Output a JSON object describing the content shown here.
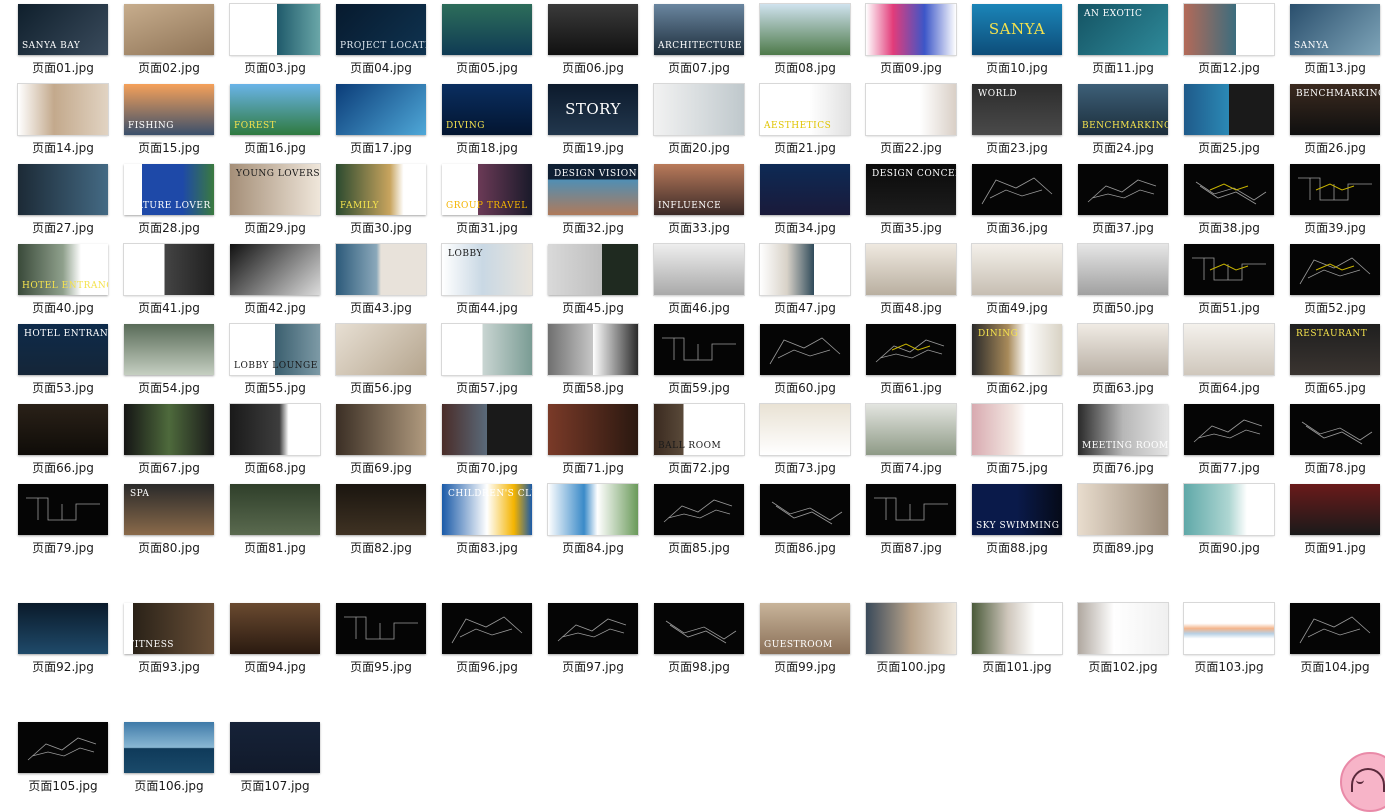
{
  "files": [
    {
      "name": "页面01.jpg",
      "bg": "linear-gradient(135deg,#0f1f2c,#3a4b5c)",
      "caption": "SANYA BAY",
      "ccolor": "#ffffff"
    },
    {
      "name": "页面02.jpg",
      "bg": "linear-gradient(160deg,#c7ad8d,#8f7457)"
    },
    {
      "name": "页面03.jpg",
      "bg": "linear-gradient(90deg,#ffffff 0%,#ffffff 52%,#1f5a6b 52%,#6aa7a8 100%)",
      "light": true
    },
    {
      "name": "页面04.jpg",
      "bg": "linear-gradient(135deg,#071a2e,#0f3350)",
      "caption": "PROJECT LOCATION",
      "ccolor": "#dfe8f0"
    },
    {
      "name": "页面05.jpg",
      "bg": "linear-gradient(180deg,#2d6d5a,#0f3b54)"
    },
    {
      "name": "页面06.jpg",
      "bg": "linear-gradient(180deg,#3a3a3a,#111111)"
    },
    {
      "name": "页面07.jpg",
      "bg": "linear-gradient(180deg,#6a86a0,#1e2e3b)",
      "caption": "ARCHITECTURE",
      "ccolor": "#ffffff"
    },
    {
      "name": "页面08.jpg",
      "bg": "linear-gradient(180deg,#cfe2ee,#4e7a4a)",
      "light": true
    },
    {
      "name": "页面09.jpg",
      "bg": "linear-gradient(90deg,#ffffff 0%,#e23c7a 30%,#3c56c8 65%,#ffffff 100%)",
      "light": true
    },
    {
      "name": "页面10.jpg",
      "bg": "linear-gradient(180deg,#1b85b8,#0d4d79)",
      "caption": "SANYA",
      "ccolor": "#f4e24d",
      "big": true
    },
    {
      "name": "页面11.jpg",
      "bg": "linear-gradient(135deg,#145363,#2f8a9a)",
      "caption": "AN EXOTIC",
      "ccolor": "#ffffff"
    },
    {
      "name": "页面12.jpg",
      "bg": "linear-gradient(90deg,#b36a58 0%,#3b6d7e 58%,#ffffff 58%)",
      "light": true
    },
    {
      "name": "页面13.jpg",
      "bg": "linear-gradient(135deg,#2a4f6d,#7ea4b8)",
      "caption": "SANYA",
      "ccolor": "#ffffff"
    },
    {
      "name": "页面14.jpg",
      "bg": "linear-gradient(90deg,#ffffff 0%,#c3a98c 40%,#e1d3c2 100%)",
      "light": true
    },
    {
      "name": "页面15.jpg",
      "bg": "linear-gradient(180deg,#f5a15a,#3a4f6b)",
      "caption": "FISHING",
      "ccolor": "#ffffff"
    },
    {
      "name": "页面16.jpg",
      "bg": "linear-gradient(180deg,#6ab4e8,#2f7a3f)",
      "caption": "FOREST",
      "ccolor": "#f4e24d"
    },
    {
      "name": "页面17.jpg",
      "bg": "linear-gradient(135deg,#0b3c78,#4fa8d8)"
    },
    {
      "name": "页面18.jpg",
      "bg": "linear-gradient(180deg,#0a2e60,#031530)",
      "caption": "DIVING",
      "ccolor": "#f4e24d"
    },
    {
      "name": "页面19.jpg",
      "bg": "linear-gradient(180deg,#0c1a2c,#22374d)",
      "caption": "STORY",
      "ccolor": "#ffffff",
      "big": true
    },
    {
      "name": "页面20.jpg",
      "bg": "linear-gradient(90deg,#f2f2f2,#bfc8cc)",
      "light": true
    },
    {
      "name": "页面21.jpg",
      "bg": "linear-gradient(90deg,#ffffff 0%,#ffffff 55%,#e0e0e0 100%)",
      "caption": "AESTHETICS",
      "ccolor": "#e0c400",
      "light": true
    },
    {
      "name": "页面22.jpg",
      "bg": "linear-gradient(90deg,#ffffff 0%,#ffffff 60%,#d9cfc6 100%)",
      "light": true
    },
    {
      "name": "页面23.jpg",
      "bg": "linear-gradient(180deg,#2c2c2c,#4a4a4a)",
      "caption": "WORLD",
      "ccolor": "#ffffff"
    },
    {
      "name": "页面24.jpg",
      "bg": "linear-gradient(180deg,#3d5f78,#1c2e3b)",
      "caption": "BENCHMARKING",
      "ccolor": "#f4e24d"
    },
    {
      "name": "页面25.jpg",
      "bg": "linear-gradient(90deg,#1f5a8a 0%,#2b89b5 50%,#1a1a1a 50%)"
    },
    {
      "name": "页面26.jpg",
      "bg": "linear-gradient(180deg,#3b2a1f,#0f0f0f)",
      "caption": "BENCHMARKING",
      "ccolor": "#ffffff"
    },
    {
      "name": "页面27.jpg",
      "bg": "linear-gradient(90deg,#1c2a36,#446a84)"
    },
    {
      "name": "页面28.jpg",
      "bg": "linear-gradient(90deg,#ffffff 0%,#ffffff 20%,#1e49a8 20%,#1e49a8 65%,#3a7a3f 100%)",
      "caption": "NATURE LOVER",
      "ccolor": "#ffffff"
    },
    {
      "name": "页面29.jpg",
      "bg": "linear-gradient(90deg,#a58f78,#efe6da)",
      "caption": "YOUNG LOVERS",
      "ccolor": "#1a1a1a",
      "light": true
    },
    {
      "name": "页面30.jpg",
      "bg": "linear-gradient(90deg,#2b4a2f 0%,#c8a45e 60%,#ffffff 75%)",
      "caption": "FAMILY",
      "ccolor": "#f4e24d"
    },
    {
      "name": "页面31.jpg",
      "bg": "linear-gradient(90deg,#ffffff 0%,#ffffff 40%,#6b3a56 40%,#1a1a2a 100%)",
      "caption": "GROUP TRAVEL",
      "ccolor": "#f4b400"
    },
    {
      "name": "页面32.jpg",
      "bg": "linear-gradient(180deg,#0f1f33 0%,#0f1f33 30%,#4f8fb5 30%,#b07a5a 100%)",
      "caption": "DESIGN VISION",
      "ccolor": "#ffffff"
    },
    {
      "name": "页面33.jpg",
      "bg": "linear-gradient(180deg,#b97a5a,#3a2a28)",
      "caption": "INFLUENCE",
      "ccolor": "#ffffff"
    },
    {
      "name": "页面34.jpg",
      "bg": "linear-gradient(180deg,#0d2a55,#1a1a3a)"
    },
    {
      "name": "页面35.jpg",
      "bg": "linear-gradient(180deg,#0a0a0a,#1d1d1d)",
      "caption": "DESIGN CONCEPT",
      "ccolor": "#ffffff"
    },
    {
      "name": "页面36.jpg",
      "bg": "#050505"
    },
    {
      "name": "页面37.jpg",
      "bg": "#050505"
    },
    {
      "name": "页面38.jpg",
      "bg": "#050505"
    },
    {
      "name": "页面39.jpg",
      "bg": "#050505"
    },
    {
      "name": "页面40.jpg",
      "bg": "linear-gradient(90deg,#3a4a3a 0%,#8fa08c 50%,#ffffff 70%)",
      "caption": "HOTEL ENTRANCE",
      "ccolor": "#f4e24d"
    },
    {
      "name": "页面41.jpg",
      "bg": "linear-gradient(90deg,#ffffff 0%,#ffffff 45%,#444444 45%,#1f1f1f 100%)",
      "light": true
    },
    {
      "name": "页面42.jpg",
      "bg": "linear-gradient(135deg,#111111,#dcdcdc)"
    },
    {
      "name": "页面43.jpg",
      "bg": "linear-gradient(90deg,#2c5a7a 0%,#8aa8ba 45%,#e8e2da 50%)",
      "light": true
    },
    {
      "name": "页面44.jpg",
      "bg": "linear-gradient(90deg,#ffffff 0%,#c9d8e4 45%,#e9e4dc 100%)",
      "caption": "LOBBY",
      "ccolor": "#1a1a1a",
      "light": true
    },
    {
      "name": "页面45.jpg",
      "bg": "linear-gradient(90deg,#d9d9d9 0%,#bfbfbf 60%,#1f2a20 60%)"
    },
    {
      "name": "页面46.jpg",
      "bg": "linear-gradient(180deg,#eeeeee,#a9a9a9)",
      "light": true
    },
    {
      "name": "页面47.jpg",
      "bg": "linear-gradient(90deg,#ffffff 0%,#d8d2c8 30%,#2f4a5a 60%,#ffffff 60%)",
      "light": true
    },
    {
      "name": "页面48.jpg",
      "bg": "linear-gradient(180deg,#efe9e0,#b9afa0)",
      "light": true
    },
    {
      "name": "页面49.jpg",
      "bg": "linear-gradient(180deg,#f4f0ea,#c6beb2)",
      "light": true
    },
    {
      "name": "页面50.jpg",
      "bg": "linear-gradient(180deg,#e6e6e6,#a0a0a0)",
      "light": true
    },
    {
      "name": "页面51.jpg",
      "bg": "#050505"
    },
    {
      "name": "页面52.jpg",
      "bg": "#050505"
    },
    {
      "name": "页面53.jpg",
      "bg": "linear-gradient(180deg,#0d2a4a,#152638)",
      "caption": "HOTEL ENTRANCE",
      "ccolor": "#ffffff"
    },
    {
      "name": "页面54.jpg",
      "bg": "linear-gradient(180deg,#596b58,#c5cfc1)"
    },
    {
      "name": "页面55.jpg",
      "bg": "linear-gradient(90deg,#ffffff 0%,#ffffff 50%,#3b5f6f 50%,#7d9aa6 100%)",
      "caption": "LOBBY LOUNGE",
      "ccolor": "#1a1a1a",
      "light": true
    },
    {
      "name": "页面56.jpg",
      "bg": "linear-gradient(135deg,#e7dfd3,#b5a58e)",
      "light": true
    },
    {
      "name": "页面57.jpg",
      "bg": "linear-gradient(90deg,#ffffff 0%,#ffffff 45%,#c9d5d2 45%,#7a9c94 100%)",
      "light": true
    },
    {
      "name": "页面58.jpg",
      "bg": "linear-gradient(90deg,#6f6f6f 0%,#c7c7c7 50%,#ffffff 50%,#2a2a2a 100%)",
      "light": true
    },
    {
      "name": "页面59.jpg",
      "bg": "#050505"
    },
    {
      "name": "页面60.jpg",
      "bg": "#050505"
    },
    {
      "name": "页面61.jpg",
      "bg": "#050505"
    },
    {
      "name": "页面62.jpg",
      "bg": "linear-gradient(90deg,#2a2a2a 0%,#a88a5a 40%,#ffffff 60%,#d8d2c4 100%)",
      "caption": "DINING",
      "ccolor": "#f4e24d"
    },
    {
      "name": "页面63.jpg",
      "bg": "linear-gradient(180deg,#f0ebe4,#b9b0a5)",
      "light": true
    },
    {
      "name": "页面64.jpg",
      "bg": "linear-gradient(180deg,#f4f1ec,#cfc7bc)",
      "light": true
    },
    {
      "name": "页面65.jpg",
      "bg": "linear-gradient(180deg,#1f1f1f,#3a3430)",
      "caption": "RESTAURANT",
      "ccolor": "#f4e24d"
    },
    {
      "name": "页面66.jpg",
      "bg": "linear-gradient(180deg,#2a2118,#0f0c08)"
    },
    {
      "name": "页面67.jpg",
      "bg": "linear-gradient(90deg,#151515 0%,#4e6a3c 50%,#1a1a1a 100%)"
    },
    {
      "name": "页面68.jpg",
      "bg": "linear-gradient(90deg,#1a1a1a 0%,#3d3d3d 55%,#ffffff 65%)",
      "light": true
    },
    {
      "name": "页面69.jpg",
      "bg": "linear-gradient(90deg,#3b2f25,#b09a7e)"
    },
    {
      "name": "页面70.jpg",
      "bg": "linear-gradient(90deg,#4a2c28 0%,#5a6a7a 50%,#1a1a1a 50%)"
    },
    {
      "name": "页面71.jpg",
      "bg": "linear-gradient(90deg,#7a3a28,#2a1810)"
    },
    {
      "name": "页面72.jpg",
      "bg": "linear-gradient(90deg,#3a2a1f 0%,#5a4a3a 33%,#ffffff 33%)",
      "caption": "BALL ROOM",
      "ccolor": "#1a1a1a",
      "light": true
    },
    {
      "name": "页面73.jpg",
      "bg": "linear-gradient(180deg,#e9e2d4,#ffffff)",
      "light": true
    },
    {
      "name": "页面74.jpg",
      "bg": "linear-gradient(180deg,#e3e5e0,#8e9a86)",
      "light": true
    },
    {
      "name": "页面75.jpg",
      "bg": "linear-gradient(90deg,#d8aab0 0%,#f2e6e1 45%,#ffffff 60%)",
      "light": true
    },
    {
      "name": "页面76.jpg",
      "bg": "linear-gradient(90deg,#2a2a2a 0%,#b7b7b7 50%,#e5e5e5 100%)",
      "caption": "MEETING ROOM",
      "ccolor": "#ffffff"
    },
    {
      "name": "页面77.jpg",
      "bg": "#050505"
    },
    {
      "name": "页面78.jpg",
      "bg": "#050505"
    },
    {
      "name": "页面79.jpg",
      "bg": "#050505"
    },
    {
      "name": "页面80.jpg",
      "bg": "linear-gradient(180deg,#2a2a2a,#8a6a4a)",
      "caption": "SPA",
      "ccolor": "#ffffff"
    },
    {
      "name": "页面81.jpg",
      "bg": "linear-gradient(180deg,#2f3f2a,#5a6a4f)"
    },
    {
      "name": "页面82.jpg",
      "bg": "linear-gradient(180deg,#1a150f,#3f3223)"
    },
    {
      "name": "页面83.jpg",
      "bg": "linear-gradient(90deg,#1a5aa8 0%,#ffffff 50%,#f4b400 80%,#1a5aa8 100%)",
      "caption": "CHILDREN'S CLUB",
      "ccolor": "#ffffff"
    },
    {
      "name": "页面84.jpg",
      "bg": "linear-gradient(90deg,#ffffff 0%,#3a8ac8 40%,#ffffff 55%,#6a9a5a 100%)",
      "light": true
    },
    {
      "name": "页面85.jpg",
      "bg": "#050505"
    },
    {
      "name": "页面86.jpg",
      "bg": "#050505"
    },
    {
      "name": "页面87.jpg",
      "bg": "#050505"
    },
    {
      "name": "页面88.jpg",
      "bg": "linear-gradient(90deg,#0a1a4a 0%,#0a1a4a 50%,#050a18 100%)",
      "caption": "SKY SWIMMING POOL",
      "ccolor": "#ffffff"
    },
    {
      "name": "页面89.jpg",
      "bg": "linear-gradient(90deg,#e8dccd,#9a8a78)",
      "light": true
    },
    {
      "name": "页面90.jpg",
      "bg": "linear-gradient(90deg,#5fa8a8 0%,#aed6d2 50%,#ffffff 70%)",
      "light": true
    },
    {
      "name": "页面91.jpg",
      "bg": "linear-gradient(180deg,#6a1a1a,#1a1a1a)"
    },
    {
      "name": "页面92.jpg",
      "bg": "linear-gradient(180deg,#0a1a2a,#1f4a6a)"
    },
    {
      "name": "页面93.jpg",
      "bg": "linear-gradient(90deg,#ffffff 0%,#ffffff 10%,#2a2218 10%,#6a5038 100%)",
      "caption": "FITNESS",
      "ccolor": "#ffffff"
    },
    {
      "name": "页面94.jpg",
      "bg": "linear-gradient(180deg,#6a4a30,#2a1a10)"
    },
    {
      "name": "页面95.jpg",
      "bg": "#050505"
    },
    {
      "name": "页面96.jpg",
      "bg": "#050505"
    },
    {
      "name": "页面97.jpg",
      "bg": "#050505"
    },
    {
      "name": "页面98.jpg",
      "bg": "#050505"
    },
    {
      "name": "页面99.jpg",
      "bg": "linear-gradient(180deg,#c8b49a,#8a7058)",
      "caption": "GUESTROOM",
      "ccolor": "#ffffff"
    },
    {
      "name": "页面100.jpg",
      "bg": "linear-gradient(90deg,#3a4a5a 0%,#b7a28a 50%,#eee7dc 100%)",
      "light": true
    },
    {
      "name": "页面101.jpg",
      "bg": "linear-gradient(90deg,#4a5a3a 0%,#cfc7bc 40%,#ffffff 70%)",
      "light": true
    },
    {
      "name": "页面102.jpg",
      "bg": "linear-gradient(90deg,#b0a8a0 0%,#ffffff 40%,#f0f0f0 100%)",
      "light": true
    },
    {
      "name": "页面103.jpg",
      "bg": "linear-gradient(180deg,#ffffff 0%,#ffffff 40%,#f4b48a 50%,#b8d0e4 60%,#ffffff 70%)",
      "light": true
    },
    {
      "name": "页面104.jpg",
      "bg": "#050505"
    },
    {
      "name": "页面105.jpg",
      "bg": "#050505"
    },
    {
      "name": "页面106.jpg",
      "bg": "linear-gradient(180deg,#3f7aa8 0%,#8ab8d4 50%,#0f3a5a 52%,#1a4a6a 100%)"
    },
    {
      "name": "页面107.jpg",
      "bg": "linear-gradient(180deg,#162238,#111a2b)"
    }
  ],
  "colors": {
    "label_text": "#1a1a1a",
    "background": "#ffffff",
    "plan_line": "#9a9a9a",
    "plan_accent": "#c8b400"
  }
}
